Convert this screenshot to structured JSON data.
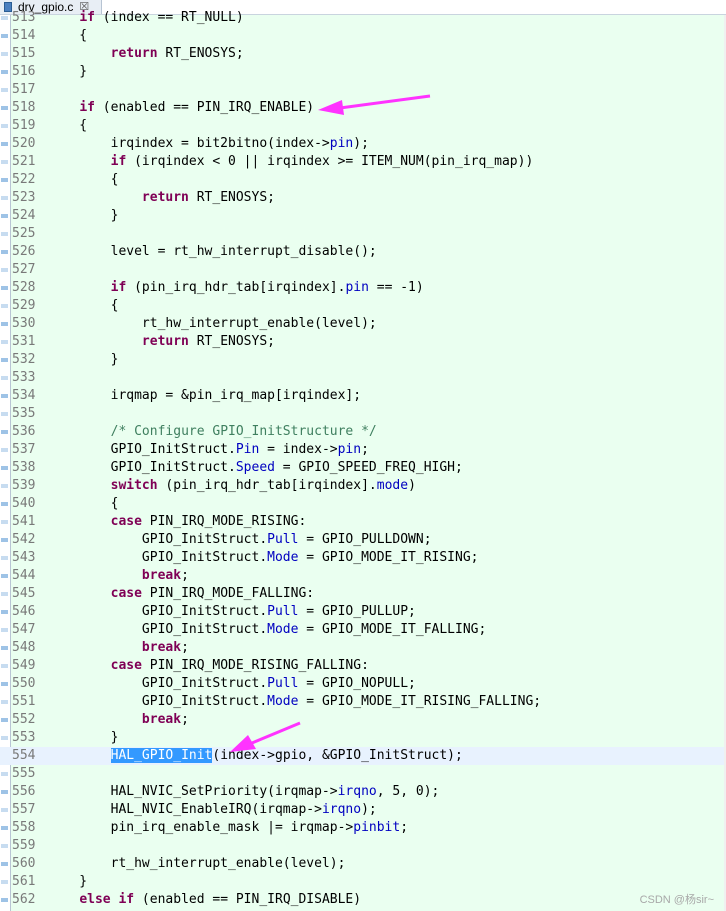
{
  "tab": {
    "title": "drv_gpio.c",
    "close_glyph": "☒"
  },
  "watermark": "CSDN @杨sir~",
  "colors": {
    "editor_bg": "#eafff0",
    "keyword": "#7f0055",
    "field": "#0000c0",
    "comment": "#3f7f5f",
    "selection": "#3399ff",
    "arrow": "#ff33ff"
  },
  "lines": [
    {
      "n": "513",
      "t": [
        [
          "",
          "    "
        ],
        [
          "kw",
          "if"
        ],
        [
          "",
          " (index == RT_NULL)"
        ]
      ]
    },
    {
      "n": "514",
      "t": [
        [
          "",
          "    {"
        ]
      ]
    },
    {
      "n": "515",
      "t": [
        [
          "",
          "        "
        ],
        [
          "kw",
          "return"
        ],
        [
          "",
          " RT_ENOSYS;"
        ]
      ]
    },
    {
      "n": "516",
      "t": [
        [
          "",
          "    }"
        ]
      ]
    },
    {
      "n": "517",
      "t": [
        [
          "",
          ""
        ]
      ]
    },
    {
      "n": "518",
      "t": [
        [
          "",
          "    "
        ],
        [
          "kw",
          "if"
        ],
        [
          "",
          " (enabled == PIN_IRQ_ENABLE)"
        ]
      ]
    },
    {
      "n": "519",
      "t": [
        [
          "",
          "    {"
        ]
      ]
    },
    {
      "n": "520",
      "t": [
        [
          "",
          "        irqindex = bit2bitno(index->"
        ],
        [
          "fld",
          "pin"
        ],
        [
          "",
          ");"
        ]
      ]
    },
    {
      "n": "521",
      "t": [
        [
          "",
          "        "
        ],
        [
          "kw",
          "if"
        ],
        [
          "",
          " (irqindex < 0 || irqindex >= ITEM_NUM(pin_irq_map))"
        ]
      ]
    },
    {
      "n": "522",
      "t": [
        [
          "",
          "        {"
        ]
      ]
    },
    {
      "n": "523",
      "t": [
        [
          "",
          "            "
        ],
        [
          "kw",
          "return"
        ],
        [
          "",
          " RT_ENOSYS;"
        ]
      ]
    },
    {
      "n": "524",
      "t": [
        [
          "",
          "        }"
        ]
      ]
    },
    {
      "n": "525",
      "t": [
        [
          "",
          ""
        ]
      ]
    },
    {
      "n": "526",
      "t": [
        [
          "",
          "        level = rt_hw_interrupt_disable();"
        ]
      ]
    },
    {
      "n": "527",
      "t": [
        [
          "",
          ""
        ]
      ]
    },
    {
      "n": "528",
      "t": [
        [
          "",
          "        "
        ],
        [
          "kw",
          "if"
        ],
        [
          "",
          " (pin_irq_hdr_tab[irqindex]."
        ],
        [
          "fld",
          "pin"
        ],
        [
          "",
          " == -1)"
        ]
      ]
    },
    {
      "n": "529",
      "t": [
        [
          "",
          "        {"
        ]
      ]
    },
    {
      "n": "530",
      "t": [
        [
          "",
          "            rt_hw_interrupt_enable(level);"
        ]
      ]
    },
    {
      "n": "531",
      "t": [
        [
          "",
          "            "
        ],
        [
          "kw",
          "return"
        ],
        [
          "",
          " RT_ENOSYS;"
        ]
      ]
    },
    {
      "n": "532",
      "t": [
        [
          "",
          "        }"
        ]
      ]
    },
    {
      "n": "533",
      "t": [
        [
          "",
          ""
        ]
      ]
    },
    {
      "n": "534",
      "t": [
        [
          "",
          "        irqmap = &pin_irq_map[irqindex];"
        ]
      ]
    },
    {
      "n": "535",
      "t": [
        [
          "",
          ""
        ]
      ]
    },
    {
      "n": "536",
      "t": [
        [
          "",
          "        "
        ],
        [
          "cmt",
          "/* Configure GPIO_InitStructure */"
        ]
      ]
    },
    {
      "n": "537",
      "t": [
        [
          "",
          "        GPIO_InitStruct."
        ],
        [
          "fld",
          "Pin"
        ],
        [
          "",
          " = index->"
        ],
        [
          "fld",
          "pin"
        ],
        [
          "",
          ";"
        ]
      ]
    },
    {
      "n": "538",
      "t": [
        [
          "",
          "        GPIO_InitStruct."
        ],
        [
          "fld",
          "Speed"
        ],
        [
          "",
          " = GPIO_SPEED_FREQ_HIGH;"
        ]
      ]
    },
    {
      "n": "539",
      "t": [
        [
          "",
          "        "
        ],
        [
          "kw",
          "switch"
        ],
        [
          "",
          " (pin_irq_hdr_tab[irqindex]."
        ],
        [
          "fld",
          "mode"
        ],
        [
          "",
          ")"
        ]
      ]
    },
    {
      "n": "540",
      "t": [
        [
          "",
          "        {"
        ]
      ]
    },
    {
      "n": "541",
      "t": [
        [
          "",
          "        "
        ],
        [
          "kw",
          "case"
        ],
        [
          "",
          " PIN_IRQ_MODE_RISING:"
        ]
      ]
    },
    {
      "n": "542",
      "t": [
        [
          "",
          "            GPIO_InitStruct."
        ],
        [
          "fld",
          "Pull"
        ],
        [
          "",
          " = GPIO_PULLDOWN;"
        ]
      ]
    },
    {
      "n": "543",
      "t": [
        [
          "",
          "            GPIO_InitStruct."
        ],
        [
          "fld",
          "Mode"
        ],
        [
          "",
          " = GPIO_MODE_IT_RISING;"
        ]
      ]
    },
    {
      "n": "544",
      "t": [
        [
          "",
          "            "
        ],
        [
          "kw",
          "break"
        ],
        [
          "",
          ";"
        ]
      ]
    },
    {
      "n": "545",
      "t": [
        [
          "",
          "        "
        ],
        [
          "kw",
          "case"
        ],
        [
          "",
          " PIN_IRQ_MODE_FALLING:"
        ]
      ]
    },
    {
      "n": "546",
      "t": [
        [
          "",
          "            GPIO_InitStruct."
        ],
        [
          "fld",
          "Pull"
        ],
        [
          "",
          " = GPIO_PULLUP;"
        ]
      ]
    },
    {
      "n": "547",
      "t": [
        [
          "",
          "            GPIO_InitStruct."
        ],
        [
          "fld",
          "Mode"
        ],
        [
          "",
          " = GPIO_MODE_IT_FALLING;"
        ]
      ]
    },
    {
      "n": "548",
      "t": [
        [
          "",
          "            "
        ],
        [
          "kw",
          "break"
        ],
        [
          "",
          ";"
        ]
      ]
    },
    {
      "n": "549",
      "t": [
        [
          "",
          "        "
        ],
        [
          "kw",
          "case"
        ],
        [
          "",
          " PIN_IRQ_MODE_RISING_FALLING:"
        ]
      ]
    },
    {
      "n": "550",
      "t": [
        [
          "",
          "            GPIO_InitStruct."
        ],
        [
          "fld",
          "Pull"
        ],
        [
          "",
          " = GPIO_NOPULL;"
        ]
      ]
    },
    {
      "n": "551",
      "t": [
        [
          "",
          "            GPIO_InitStruct."
        ],
        [
          "fld",
          "Mode"
        ],
        [
          "",
          " = GPIO_MODE_IT_RISING_FALLING;"
        ]
      ]
    },
    {
      "n": "552",
      "t": [
        [
          "",
          "            "
        ],
        [
          "kw",
          "break"
        ],
        [
          "",
          ";"
        ]
      ]
    },
    {
      "n": "553",
      "t": [
        [
          "",
          "        }"
        ]
      ]
    },
    {
      "n": "554",
      "current": true,
      "t": [
        [
          "",
          "        "
        ],
        [
          "sel",
          "HAL_GPIO_Init"
        ],
        [
          "",
          "(index->gpio, &GPIO_InitStruct);"
        ]
      ]
    },
    {
      "n": "555",
      "t": [
        [
          "",
          ""
        ]
      ]
    },
    {
      "n": "556",
      "t": [
        [
          "",
          "        HAL_NVIC_SetPriority(irqmap->"
        ],
        [
          "fld",
          "irqno"
        ],
        [
          "",
          ", 5, 0);"
        ]
      ]
    },
    {
      "n": "557",
      "t": [
        [
          "",
          "        HAL_NVIC_EnableIRQ(irqmap->"
        ],
        [
          "fld",
          "irqno"
        ],
        [
          "",
          ");"
        ]
      ]
    },
    {
      "n": "558",
      "t": [
        [
          "",
          "        pin_irq_enable_mask |= irqmap->"
        ],
        [
          "fld",
          "pinbit"
        ],
        [
          "",
          ";"
        ]
      ]
    },
    {
      "n": "559",
      "t": [
        [
          "",
          ""
        ]
      ]
    },
    {
      "n": "560",
      "t": [
        [
          "",
          "        rt_hw_interrupt_enable(level);"
        ]
      ]
    },
    {
      "n": "561",
      "t": [
        [
          "",
          "    }"
        ]
      ]
    },
    {
      "n": "562",
      "t": [
        [
          "",
          "    "
        ],
        [
          "kw",
          "else"
        ],
        [
          "",
          " "
        ],
        [
          "kw",
          "if"
        ],
        [
          "",
          " (enabled == PIN_IRQ_DISABLE)"
        ]
      ]
    }
  ]
}
